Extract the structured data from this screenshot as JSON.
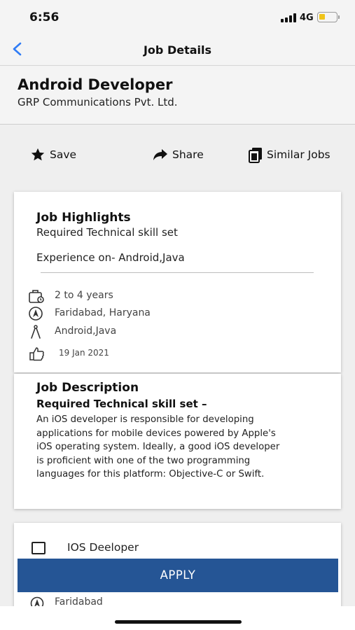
{
  "status_bar": {
    "time": "6:56",
    "network": "4G",
    "battery_fraction": 0.3,
    "icons": [
      "signal-icon",
      "battery-icon"
    ]
  },
  "nav": {
    "title": "Job Details",
    "back_icon": "chevron-left-icon"
  },
  "job": {
    "title": "Android Developer",
    "company": "GRP Communications Pvt. Ltd."
  },
  "actions": [
    {
      "label": "Save",
      "icon": "star-icon"
    },
    {
      "label": "Share",
      "icon": "share-arrow-icon"
    },
    {
      "label": "Similar Jobs",
      "icon": "copy-document-icon"
    }
  ],
  "highlights": {
    "title": "Job Highlights",
    "subtitle": "Required Technical skill set",
    "experience_line": "Experience on- Android,Java",
    "items": [
      {
        "icon": "briefcase-icon",
        "text": "2 to 4 years"
      },
      {
        "icon": "location-icon",
        "text": "Faridabad, Haryana"
      },
      {
        "icon": "compass-icon",
        "text": "Android,Java"
      },
      {
        "icon": "thumbs-up-icon",
        "text": "19 Jan 2021"
      }
    ]
  },
  "description": {
    "title": "Job Description",
    "subtitle": "Required Technical skill set –",
    "lines": [
      "An iOS developer is responsible for developing",
      "applications for mobile devices powered by Apple's",
      "iOS operating system. Ideally, a good iOS developer",
      "is proficient with one of the two programming",
      "languages for this platform: Objective-C or Swift."
    ]
  },
  "next_job": {
    "title": "IOS Deeloper",
    "location": "Faridabad",
    "checked": false
  },
  "apply": {
    "label": "APPLY",
    "color": "#255595"
  }
}
